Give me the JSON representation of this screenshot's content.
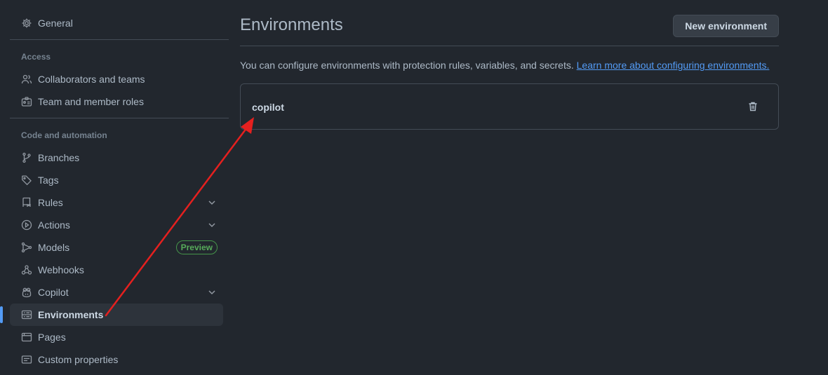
{
  "sidebar": {
    "general": "General",
    "access_heading": "Access",
    "access_items": [
      {
        "label": "Collaborators and teams",
        "icon": "people-icon"
      },
      {
        "label": "Team and member roles",
        "icon": "id-badge-icon"
      }
    ],
    "code_heading": "Code and automation",
    "code_items": {
      "branches": "Branches",
      "tags": "Tags",
      "rules": "Rules",
      "actions": "Actions",
      "models": "Models",
      "models_badge": "Preview",
      "webhooks": "Webhooks",
      "copilot": "Copilot",
      "environments": "Environments",
      "pages": "Pages",
      "custom_properties": "Custom properties"
    },
    "active_item": "Environments"
  },
  "main": {
    "title": "Environments",
    "new_button": "New environment",
    "description": "You can configure environments with protection rules, variables, and secrets.",
    "learn_more": "Learn more about configuring environments.",
    "environments": [
      {
        "name": "copilot"
      }
    ]
  },
  "colors": {
    "background": "#22272e",
    "accent": "#539bf5",
    "annotation_arrow": "#e5201f",
    "preview_badge": "#57ab5a"
  }
}
